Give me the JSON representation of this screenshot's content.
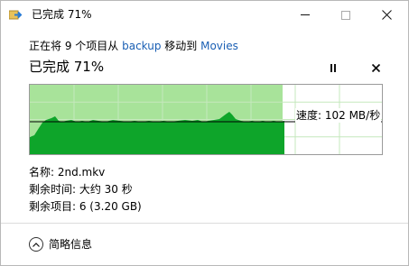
{
  "window": {
    "title": "已完成 71%"
  },
  "summary": {
    "prefix": "正在将 9 个项目从 ",
    "source": "backup",
    "middle": " 移动到 ",
    "destination": "Movies"
  },
  "status": {
    "text": "已完成 71%",
    "progress_percent": 71
  },
  "graph": {
    "speed_label": "速度: 102 MB/秒"
  },
  "details": {
    "name": "名称: 2nd.mkv",
    "time_remaining": "剩余时间: 大约 30 秒",
    "items_remaining": "剩余项目: 6 (3.20 GB)"
  },
  "footer": {
    "label": "简略信息"
  },
  "colors": {
    "graph_done": "#a8e39a",
    "graph_fill": "#0ea52a",
    "grid": "#c5e8bd",
    "link": "#1a5fb4"
  }
}
